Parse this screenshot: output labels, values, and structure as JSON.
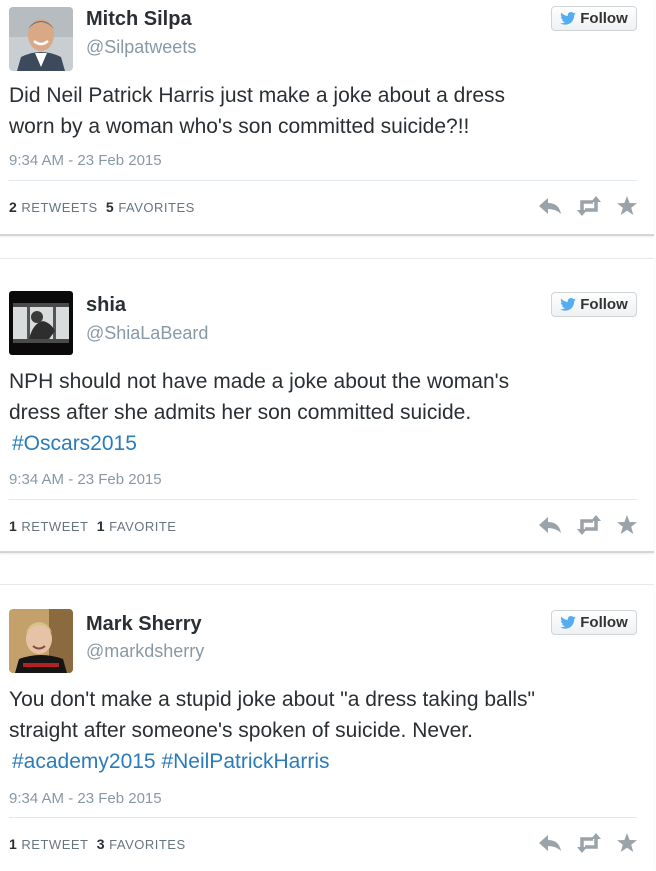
{
  "follow_label": "Follow",
  "colors": {
    "hashtag": "#2b7bb9",
    "follow_bird": "#55acee",
    "action_icons": "#9aa3a9"
  },
  "tweets": [
    {
      "name": "Mitch Silpa",
      "handle": "@Silpatweets",
      "avatar_icon": "man-avatar-icon",
      "lines": [
        [
          {
            "text": "Did Neil Patrick Harris just make a joke about a dress"
          }
        ],
        [
          {
            "text": "worn by a woman who's son committed suicide?!!"
          }
        ]
      ],
      "timestamp": "9:34 AM - 23 Feb 2015",
      "retweets": "2",
      "retweets_label": "Retweets",
      "favorites": "5",
      "favorites_label": "Favorites"
    },
    {
      "name": "shia",
      "handle": "@ShiaLaBeard",
      "avatar_icon": "video-still-avatar-icon",
      "lines": [
        [
          {
            "text": "NPH should not have made a joke about the woman's"
          }
        ],
        [
          {
            "text": "dress after she admits her son committed suicide."
          }
        ],
        [
          {
            "text": "#Oscars2015",
            "hashtag": true
          }
        ]
      ],
      "timestamp": "9:34 AM - 23 Feb 2015",
      "retweets": "1",
      "retweets_label": "Retweet",
      "favorites": "1",
      "favorites_label": "Favorite"
    },
    {
      "name": "Mark Sherry",
      "handle": "@markdsherry",
      "avatar_icon": "man-avatar-icon",
      "lines": [
        [
          {
            "text": "You don't make a stupid joke about \"a dress taking balls\""
          }
        ],
        [
          {
            "text": "straight after someone's spoken of suicide. Never."
          }
        ],
        [
          {
            "text": "#academy2015",
            "hashtag": true
          },
          {
            "text": " "
          },
          {
            "text": "#NeilPatrickHarris",
            "hashtag": true
          }
        ]
      ],
      "timestamp": "9:34 AM - 23 Feb 2015",
      "retweets": "1",
      "retweets_label": "Retweet",
      "favorites": "3",
      "favorites_label": "Favorites"
    }
  ]
}
